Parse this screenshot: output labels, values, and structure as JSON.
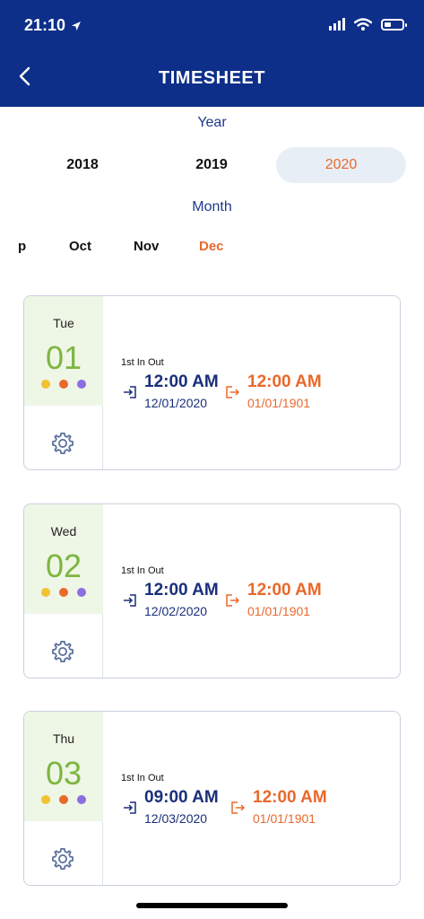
{
  "status_bar": {
    "time": "21:10"
  },
  "header": {
    "title": "TIMESHEET"
  },
  "year_section": {
    "label": "Year",
    "years": [
      "2018",
      "2019",
      "2020"
    ],
    "selected": "2020"
  },
  "month_section": {
    "label": "Month",
    "months": [
      "p",
      "Oct",
      "Nov",
      "Dec"
    ],
    "selected": "Dec"
  },
  "days": [
    {
      "dow": "Tue",
      "day": "01",
      "label": "1st In Out",
      "in_time": "12:00 AM",
      "in_date": "12/01/2020",
      "out_time": "12:00 AM",
      "out_date": "01/01/1901"
    },
    {
      "dow": "Wed",
      "day": "02",
      "label": "1st In Out",
      "in_time": "12:00 AM",
      "in_date": "12/02/2020",
      "out_time": "12:00 AM",
      "out_date": "01/01/1901"
    },
    {
      "dow": "Thu",
      "day": "03",
      "label": "1st In Out",
      "in_time": "09:00 AM",
      "in_date": "12/03/2020",
      "out_time": "12:00 AM",
      "out_date": "01/01/1901"
    }
  ],
  "colors": {
    "header_bg": "#0d2f8a",
    "accent_orange": "#e8692c",
    "day_green": "#7db63f",
    "dot_yellow": "#f2c230",
    "dot_orange": "#e8692c",
    "dot_purple": "#8b6fe0"
  },
  "icons": [
    "location-arrow-icon",
    "signal-icon",
    "wifi-icon",
    "battery-icon",
    "back-chevron-icon",
    "clock-in-icon",
    "clock-out-icon",
    "gear-icon"
  ]
}
